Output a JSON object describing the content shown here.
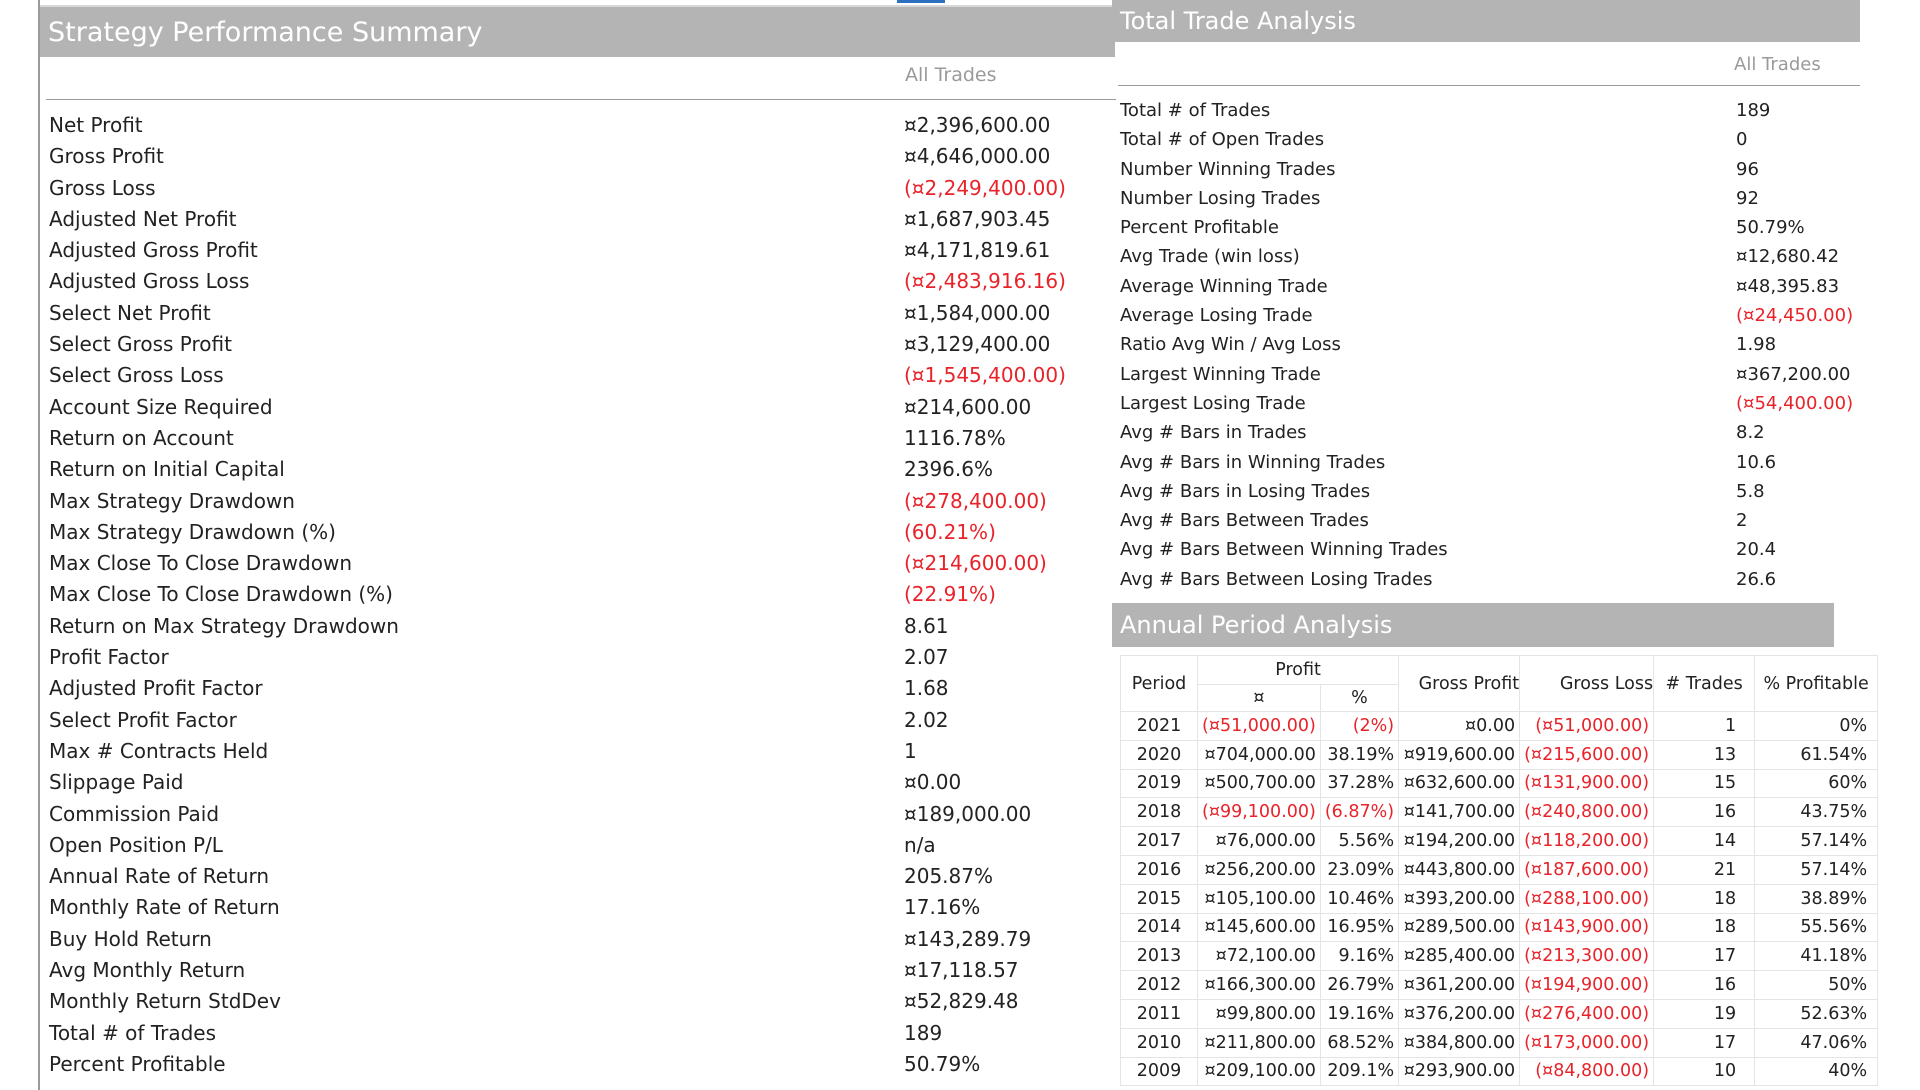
{
  "strategy_summary": {
    "title": "Strategy Performance Summary",
    "column": "All Trades",
    "rows": [
      {
        "label": "Net Profit",
        "value": "¤2,396,600.00",
        "negative": false
      },
      {
        "label": "Gross Profit",
        "value": "¤4,646,000.00",
        "negative": false
      },
      {
        "label": "Gross Loss",
        "value": "(¤2,249,400.00)",
        "negative": true
      },
      {
        "label": "Adjusted Net Profit",
        "value": "¤1,687,903.45",
        "negative": false
      },
      {
        "label": "Adjusted Gross Profit",
        "value": "¤4,171,819.61",
        "negative": false
      },
      {
        "label": "Adjusted Gross Loss",
        "value": "(¤2,483,916.16)",
        "negative": true
      },
      {
        "label": "Select Net Profit",
        "value": "¤1,584,000.00",
        "negative": false
      },
      {
        "label": "Select Gross Profit",
        "value": "¤3,129,400.00",
        "negative": false
      },
      {
        "label": "Select Gross Loss",
        "value": "(¤1,545,400.00)",
        "negative": true
      },
      {
        "label": "Account Size Required",
        "value": "¤214,600.00",
        "negative": false
      },
      {
        "label": "Return on Account",
        "value": "1116.78%",
        "negative": false
      },
      {
        "label": "Return on Initial Capital",
        "value": "2396.6%",
        "negative": false
      },
      {
        "label": "Max Strategy Drawdown",
        "value": "(¤278,400.00)",
        "negative": true
      },
      {
        "label": "Max Strategy Drawdown (%)",
        "value": "(60.21%)",
        "negative": true
      },
      {
        "label": "Max Close To Close Drawdown",
        "value": "(¤214,600.00)",
        "negative": true
      },
      {
        "label": "Max Close To Close Drawdown (%)",
        "value": "(22.91%)",
        "negative": true
      },
      {
        "label": "Return on Max Strategy Drawdown",
        "value": "8.61",
        "negative": false
      },
      {
        "label": "Profit Factor",
        "value": "2.07",
        "negative": false
      },
      {
        "label": "Adjusted Profit Factor",
        "value": "1.68",
        "negative": false
      },
      {
        "label": "Select Profit Factor",
        "value": "2.02",
        "negative": false
      },
      {
        "label": "Max # Contracts Held",
        "value": "1",
        "negative": false
      },
      {
        "label": "Slippage Paid",
        "value": "¤0.00",
        "negative": false
      },
      {
        "label": "Commission Paid",
        "value": "¤189,000.00",
        "negative": false
      },
      {
        "label": "Open Position P/L",
        "value": "n/a",
        "negative": false
      },
      {
        "label": "Annual Rate of Return",
        "value": "205.87%",
        "negative": false
      },
      {
        "label": "Monthly Rate of Return",
        "value": "17.16%",
        "negative": false
      },
      {
        "label": "Buy  Hold Return",
        "value": "¤143,289.79",
        "negative": false
      },
      {
        "label": "Avg Monthly Return",
        "value": "¤17,118.57",
        "negative": false
      },
      {
        "label": "Monthly Return StdDev",
        "value": "¤52,829.48",
        "negative": false
      },
      {
        "label": "Total # of Trades",
        "value": "189",
        "negative": false
      },
      {
        "label": "Percent Profitable",
        "value": "50.79%",
        "negative": false
      }
    ]
  },
  "trade_analysis": {
    "title": "Total Trade Analysis",
    "column": "All Trades",
    "rows": [
      {
        "label": "Total # of Trades",
        "value": "189",
        "negative": false
      },
      {
        "label": "Total # of Open Trades",
        "value": "0",
        "negative": false
      },
      {
        "label": "Number Winning Trades",
        "value": "96",
        "negative": false
      },
      {
        "label": "Number Losing Trades",
        "value": "92",
        "negative": false
      },
      {
        "label": "Percent Profitable",
        "value": "50.79%",
        "negative": false
      },
      {
        "label": "Avg Trade (win  loss)",
        "value": "¤12,680.42",
        "negative": false
      },
      {
        "label": "Average Winning Trade",
        "value": "¤48,395.83",
        "negative": false
      },
      {
        "label": "Average Losing Trade",
        "value": "(¤24,450.00)",
        "negative": true
      },
      {
        "label": "Ratio Avg Win / Avg Loss",
        "value": "1.98",
        "negative": false
      },
      {
        "label": "Largest Winning Trade",
        "value": "¤367,200.00",
        "negative": false
      },
      {
        "label": "Largest Losing Trade",
        "value": "(¤54,400.00)",
        "negative": true
      },
      {
        "label": "Avg # Bars in Trades",
        "value": "8.2",
        "negative": false
      },
      {
        "label": "Avg # Bars in Winning Trades",
        "value": "10.6",
        "negative": false
      },
      {
        "label": "Avg # Bars in Losing Trades",
        "value": "5.8",
        "negative": false
      },
      {
        "label": "Avg # Bars Between Trades",
        "value": "2",
        "negative": false
      },
      {
        "label": "Avg # Bars Between Winning Trades",
        "value": "20.4",
        "negative": false
      },
      {
        "label": "Avg # Bars Between Losing Trades",
        "value": "26.6",
        "negative": false
      }
    ]
  },
  "annual": {
    "title": "Annual Period Analysis",
    "headers": {
      "period": "Period",
      "profit": "Profit",
      "profit_currency": "¤",
      "profit_pct": "%",
      "gross_profit": "Gross Profit",
      "gross_loss": "Gross Loss",
      "trades": "# Trades",
      "pct_profitable": "% Profitable"
    },
    "rows": [
      {
        "period": "2021",
        "profit": "(¤51,000.00)",
        "pct": "(2%)",
        "gross_profit": "¤0.00",
        "gross_loss": "(¤51,000.00)",
        "trades": "1",
        "pct_profitable": "0%",
        "negative": true
      },
      {
        "period": "2020",
        "profit": "¤704,000.00",
        "pct": "38.19%",
        "gross_profit": "¤919,600.00",
        "gross_loss": "(¤215,600.00)",
        "trades": "13",
        "pct_profitable": "61.54%",
        "negative": false
      },
      {
        "period": "2019",
        "profit": "¤500,700.00",
        "pct": "37.28%",
        "gross_profit": "¤632,600.00",
        "gross_loss": "(¤131,900.00)",
        "trades": "15",
        "pct_profitable": "60%",
        "negative": false
      },
      {
        "period": "2018",
        "profit": "(¤99,100.00)",
        "pct": "(6.87%)",
        "gross_profit": "¤141,700.00",
        "gross_loss": "(¤240,800.00)",
        "trades": "16",
        "pct_profitable": "43.75%",
        "negative": true
      },
      {
        "period": "2017",
        "profit": "¤76,000.00",
        "pct": "5.56%",
        "gross_profit": "¤194,200.00",
        "gross_loss": "(¤118,200.00)",
        "trades": "14",
        "pct_profitable": "57.14%",
        "negative": false
      },
      {
        "period": "2016",
        "profit": "¤256,200.00",
        "pct": "23.09%",
        "gross_profit": "¤443,800.00",
        "gross_loss": "(¤187,600.00)",
        "trades": "21",
        "pct_profitable": "57.14%",
        "negative": false
      },
      {
        "period": "2015",
        "profit": "¤105,100.00",
        "pct": "10.46%",
        "gross_profit": "¤393,200.00",
        "gross_loss": "(¤288,100.00)",
        "trades": "18",
        "pct_profitable": "38.89%",
        "negative": false
      },
      {
        "period": "2014",
        "profit": "¤145,600.00",
        "pct": "16.95%",
        "gross_profit": "¤289,500.00",
        "gross_loss": "(¤143,900.00)",
        "trades": "18",
        "pct_profitable": "55.56%",
        "negative": false
      },
      {
        "period": "2013",
        "profit": "¤72,100.00",
        "pct": "9.16%",
        "gross_profit": "¤285,400.00",
        "gross_loss": "(¤213,300.00)",
        "trades": "17",
        "pct_profitable": "41.18%",
        "negative": false
      },
      {
        "period": "2012",
        "profit": "¤166,300.00",
        "pct": "26.79%",
        "gross_profit": "¤361,200.00",
        "gross_loss": "(¤194,900.00)",
        "trades": "16",
        "pct_profitable": "50%",
        "negative": false
      },
      {
        "period": "2011",
        "profit": "¤99,800.00",
        "pct": "19.16%",
        "gross_profit": "¤376,200.00",
        "gross_loss": "(¤276,400.00)",
        "trades": "19",
        "pct_profitable": "52.63%",
        "negative": false
      },
      {
        "period": "2010",
        "profit": "¤211,800.00",
        "pct": "68.52%",
        "gross_profit": "¤384,800.00",
        "gross_loss": "(¤173,000.00)",
        "trades": "17",
        "pct_profitable": "47.06%",
        "negative": false
      },
      {
        "period": "2009",
        "profit": "¤209,100.00",
        "pct": "209.1%",
        "gross_profit": "¤293,900.00",
        "gross_loss": "(¤84,800.00)",
        "trades": "10",
        "pct_profitable": "40%",
        "negative": false
      }
    ]
  },
  "colors": {
    "header_bg": "#b4b4b4",
    "negative": "#e8232a",
    "muted": "#9a9a9a"
  }
}
